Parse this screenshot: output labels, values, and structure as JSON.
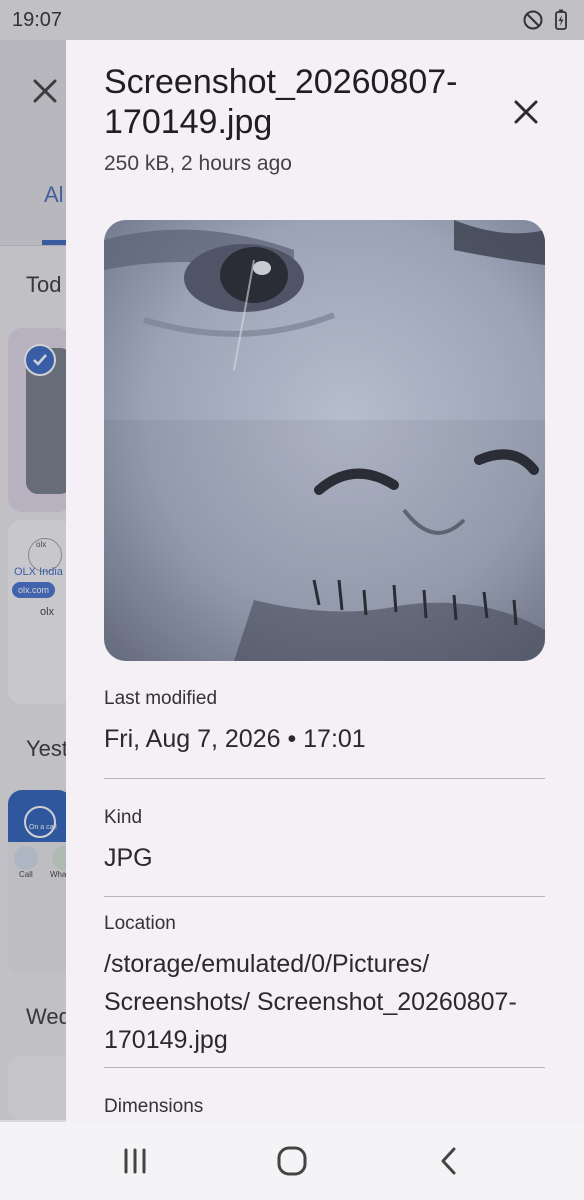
{
  "status": {
    "time": "19:07"
  },
  "background": {
    "tab_label": "Al",
    "sections": [
      "Tod",
      "Yest",
      "Wed"
    ],
    "olx_title": "OLX India",
    "olx_chip1": "olx.com",
    "olx_search": "olx",
    "call_label": "Call",
    "whatsapp_label": "Whats",
    "on_a_call": "On a call"
  },
  "panel": {
    "title": "Screenshot_20260807-170149.jpg",
    "subtitle": "250 kB, 2 hours ago",
    "details": [
      {
        "label": "Last modified",
        "value": "Fri, Aug 7, 2026 • 17:01"
      },
      {
        "label": "Kind",
        "value": "JPG"
      },
      {
        "label": "Location",
        "value": "/storage/emulated/0/Pictures/ Screenshots/ Screenshot_20260807-170149.jpg"
      },
      {
        "label": "Dimensions",
        "value": ""
      }
    ]
  },
  "colors": {
    "panel_bg": "#f5eff6",
    "accent": "#2e5fc2"
  },
  "icons": {
    "status": [
      "do-not-disturb-icon",
      "battery-charging-icon"
    ],
    "panel": [
      "close-icon"
    ],
    "nav": [
      "recents-icon",
      "home-icon",
      "back-icon"
    ]
  }
}
